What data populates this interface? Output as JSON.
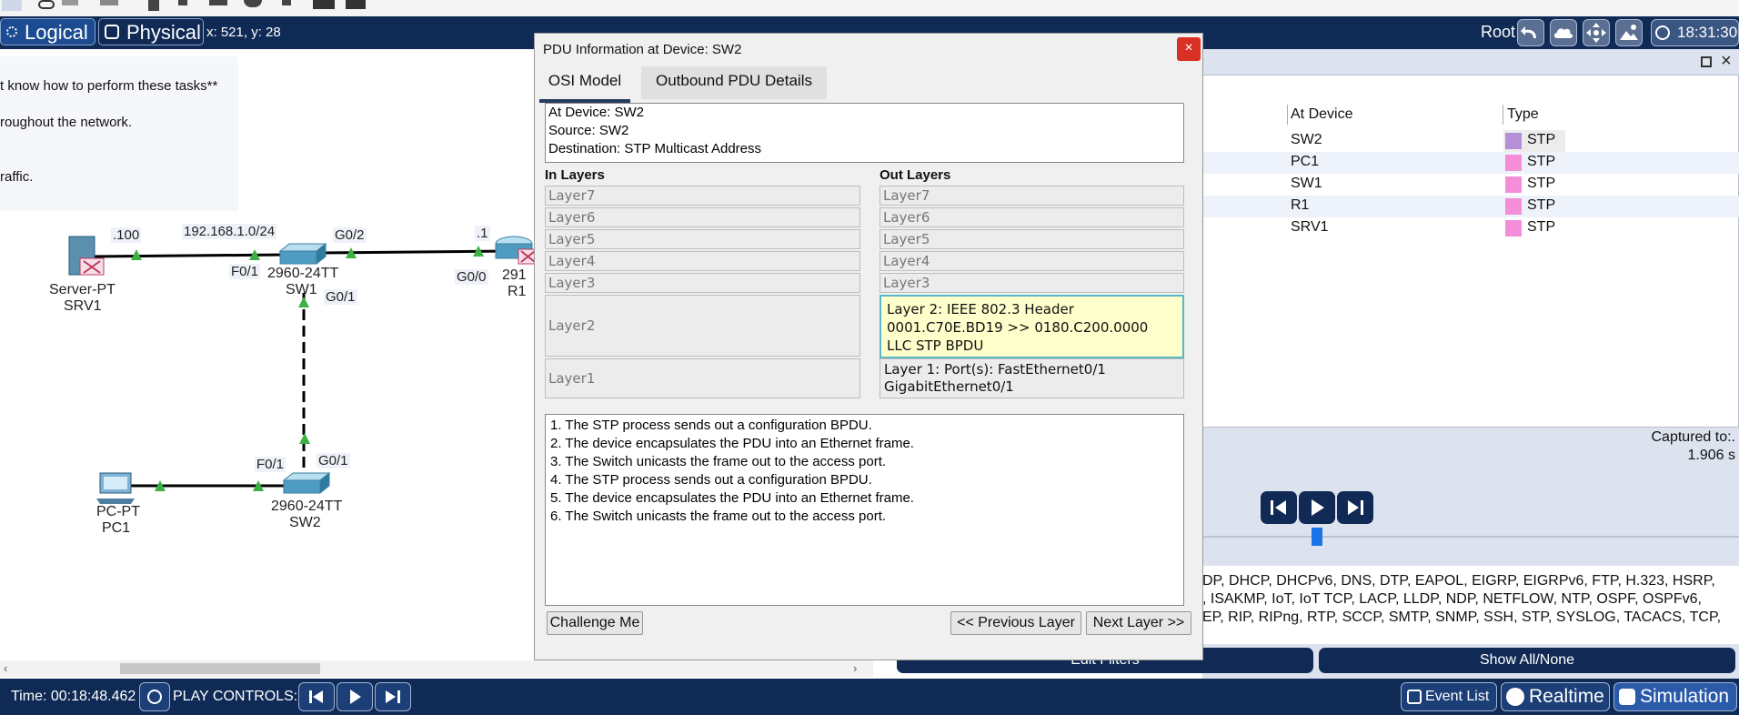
{
  "top_bar": {
    "logical_label": "Logical",
    "physical_label": "Physical",
    "coords": "x: 521, y: 28",
    "root_label": "Root",
    "clock": "18:31:30"
  },
  "instructions": {
    "lines": [
      "t know how to perform these tasks**",
      "roughout the network.",
      "raffic."
    ]
  },
  "topology": {
    "devices": {
      "srv1_type": "Server-PT",
      "srv1_name": "SRV1",
      "sw1_type": "2960-24TT",
      "sw1_name": "SW1",
      "r1_type": "291",
      "r1_name": "R1",
      "sw2_type": "2960-24TT",
      "sw2_name": "SW2",
      "pc1_type": "PC-PT",
      "pc1_name": "PC1"
    },
    "labels": {
      "srv_ip": ".100",
      "subnet": "192.168.1.0/24",
      "sw1_g02": "G0/2",
      "r1_ip": ".1",
      "sw1_f01": "F0/1",
      "r1_g00": "G0/0",
      "sw1_g01": "G0/1",
      "sw2_f01": "F0/1",
      "sw2_g01": "G0/1"
    }
  },
  "dialog": {
    "title": "PDU Information at Device: SW2",
    "close": "×",
    "tabs": [
      "OSI Model",
      "Outbound PDU Details"
    ],
    "info": {
      "device": "At Device: SW2",
      "source": "Source: SW2",
      "destination": "Destination: STP Multicast Address"
    },
    "in_layers_title": "In Layers",
    "out_layers_title": "Out Layers",
    "in_layers": [
      "Layer7",
      "Layer6",
      "Layer5",
      "Layer4",
      "Layer3",
      "Layer2",
      "Layer1"
    ],
    "out_layers": [
      "Layer7",
      "Layer6",
      "Layer5",
      "Layer4",
      "Layer3"
    ],
    "out_layer2": {
      "line1": "Layer 2: IEEE 802.3 Header",
      "line2": "0001.C70E.BD19 >> 0180.C200.0000",
      "line3": "LLC STP BPDU"
    },
    "out_layer1": {
      "line1": "Layer 1: Port(s): FastEthernet0/1",
      "line2": "GigabitEthernet0/1"
    },
    "steps": [
      "1. The STP process sends out a configuration BPDU.",
      "2. The device encapsulates the PDU into an Ethernet frame.",
      "3. The Switch unicasts the frame out to the access port.",
      "4. The STP process sends out a configuration BPDU.",
      "5. The device encapsulates the PDU into an Ethernet frame.",
      "6. The Switch unicasts the frame out to the access port."
    ],
    "buttons": {
      "challenge": "Challenge Me",
      "previous": "<< Previous Layer",
      "next": "Next Layer >>"
    }
  },
  "event_list": {
    "columns": [
      "At Device",
      "Type"
    ],
    "rows": [
      {
        "device": "SW2",
        "type": "STP",
        "color": "#b58fd8"
      },
      {
        "device": "PC1",
        "type": "STP",
        "color": "#f58ed8"
      },
      {
        "device": "SW1",
        "type": "STP",
        "color": "#f58ed8"
      },
      {
        "device": "R1",
        "type": "STP",
        "color": "#f58ed8"
      },
      {
        "device": "SRV1",
        "type": "STP",
        "color": "#f58ed8"
      }
    ],
    "captured_label": "Captured to:.",
    "captured_value": "1.906 s"
  },
  "protocols": {
    "lines": [
      "DP, DHCP, DHCPv6, DNS, DTP, EAPOL, EIGRP, EIGRPv6, FTP, H.323, HSRP,",
      ", ISAKMP, IoT, IoT TCP, LACP, LLDP, NDP, NETFLOW, NTP, OSPF, OSPFv6,",
      "EP, RIP, RIPng, RTP, SCCP, SMTP, SNMP, SSH, STP, SYSLOG, TACACS, TCP,"
    ],
    "edit_filters": "Edit Filters",
    "show_all": "Show All/None"
  },
  "bottom_bar": {
    "time": "Time: 00:18:48.462",
    "play_controls": "PLAY CONTROLS:",
    "event_list": "Event List",
    "realtime": "Realtime",
    "simulation": "Simulation"
  },
  "colors": {
    "bar_bg": "#0f2a55",
    "link_green": "#3cb043",
    "active_layer_bg": "#ffffcc",
    "stp_purple": "#b58fd8",
    "stp_pink": "#f58ed8"
  }
}
